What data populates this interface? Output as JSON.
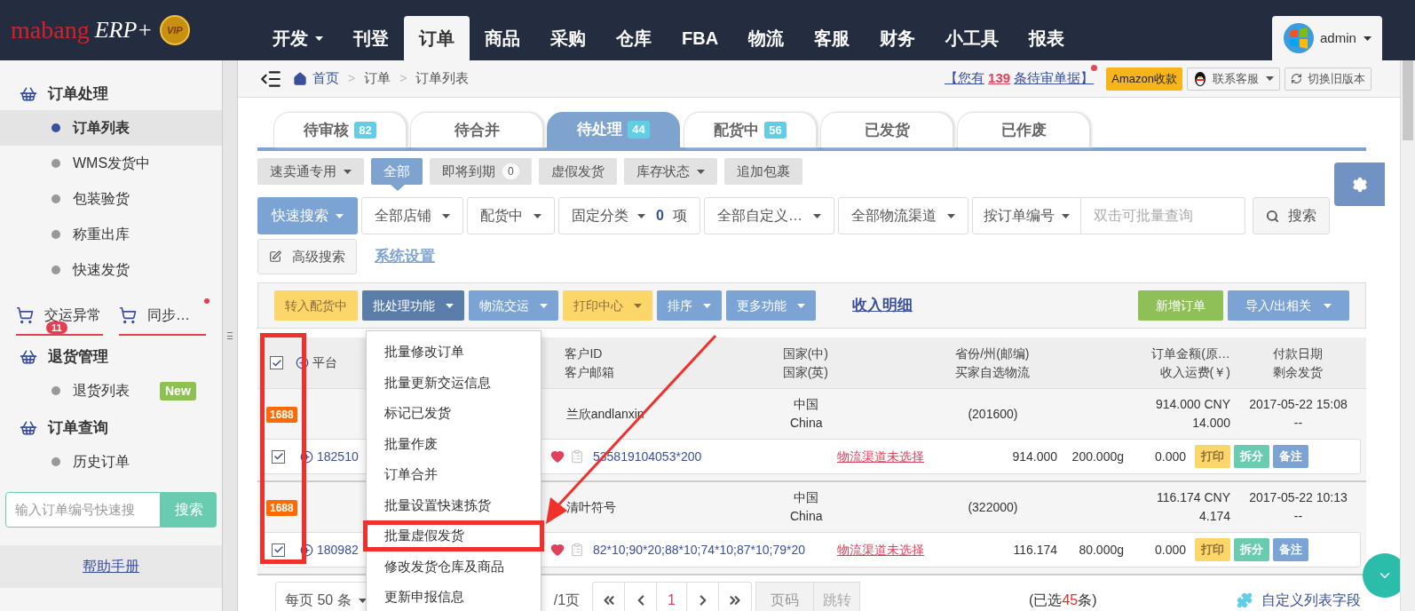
{
  "nav": {
    "logo_main": "mabang",
    "logo_suffix": "ERP+",
    "logo_badge": "VIP",
    "user": "admin",
    "items": [
      {
        "label": "开发",
        "dropdown": true,
        "selected": false
      },
      {
        "label": "刊登",
        "dropdown": false,
        "selected": false
      },
      {
        "label": "订单",
        "dropdown": false,
        "selected": true
      },
      {
        "label": "商品",
        "dropdown": false,
        "selected": false
      },
      {
        "label": "采购",
        "dropdown": false,
        "selected": false
      },
      {
        "label": "仓库",
        "dropdown": false,
        "selected": false
      },
      {
        "label": "FBA",
        "dropdown": false,
        "selected": false
      },
      {
        "label": "物流",
        "dropdown": false,
        "selected": false
      },
      {
        "label": "客服",
        "dropdown": false,
        "selected": false
      },
      {
        "label": "财务",
        "dropdown": false,
        "selected": false
      },
      {
        "label": "小工具",
        "dropdown": false,
        "selected": false
      },
      {
        "label": "报表",
        "dropdown": false,
        "selected": false
      }
    ]
  },
  "sidebar": {
    "sections": [
      {
        "kind": "group",
        "title": "订单处理",
        "items": [
          {
            "label": "订单列表",
            "selected": true
          },
          {
            "label": "WMS发货中",
            "selected": false
          },
          {
            "label": "包装验货",
            "selected": false
          },
          {
            "label": "称重出库",
            "selected": false
          },
          {
            "label": "快速发货",
            "selected": false
          }
        ]
      },
      {
        "kind": "tabs",
        "tabs": [
          {
            "label": "交运异常",
            "badge": "11",
            "dot": false
          },
          {
            "label": "同步…",
            "dot": true
          }
        ]
      },
      {
        "kind": "group",
        "title": "退货管理",
        "items": [
          {
            "label": "退货列表",
            "selected": false,
            "tag": "New"
          }
        ]
      },
      {
        "kind": "group",
        "title": "订单查询",
        "items": [
          {
            "label": "历史订单",
            "selected": false
          }
        ]
      }
    ],
    "search": {
      "placeholder": "输入订单编号快速搜",
      "button": "搜索"
    },
    "help": "帮助手册"
  },
  "breadcrumb": [
    "首页",
    "订单",
    "订单列表"
  ],
  "breadcrumb_separator": ">",
  "notice": {
    "prefix": "【您有",
    "count": "139",
    "suffix": "条待审单据】",
    "dot": true
  },
  "top_buttons": [
    {
      "kind": "amazon",
      "label": "Amazon收款"
    },
    {
      "kind": "service",
      "label": "联系客服"
    },
    {
      "kind": "switch",
      "label": "切换旧版本"
    }
  ],
  "tabs": [
    {
      "label": "待审核",
      "count": "82",
      "selected": false
    },
    {
      "label": "待合并",
      "selected": false
    },
    {
      "label": "待处理",
      "count": "44",
      "selected": true
    },
    {
      "label": "配货中",
      "count": "56",
      "selected": false
    },
    {
      "label": "已发货",
      "selected": false
    },
    {
      "label": "已作废",
      "selected": false
    }
  ],
  "sub_tabs": [
    {
      "label": "速卖通专用",
      "dropdown": true,
      "selected": false
    },
    {
      "label": "全部",
      "selected": true
    },
    {
      "label": "即将到期",
      "count": "0",
      "selected": false
    },
    {
      "label": "虚假发货",
      "selected": false
    },
    {
      "label": "库存状态",
      "dropdown": true,
      "selected": false
    },
    {
      "label": "追加包裹",
      "selected": false
    }
  ],
  "filters": [
    {
      "kind": "primary",
      "label": "快速搜索"
    },
    {
      "kind": "select",
      "label": "全部店铺"
    },
    {
      "kind": "select",
      "label": "配货中"
    },
    {
      "kind": "category",
      "label": "固定分类",
      "count": "0",
      "unit": "项"
    },
    {
      "kind": "select",
      "label": "全部自定义…"
    },
    {
      "kind": "select",
      "label": "全部物流渠道"
    }
  ],
  "search": {
    "field": "按订单编号",
    "placeholder": "双击可批量查询",
    "button": "搜索"
  },
  "advanced_search": "高级搜索",
  "system_settings": "系统设置",
  "toolbar": {
    "left": [
      {
        "label": "转入配货中",
        "color": "#fdd66a",
        "dropdown": false
      },
      {
        "label": "批处理功能",
        "color": "#5a7ea9",
        "dropdown": true
      },
      {
        "label": "物流交运",
        "color": "#7ba3d3",
        "dropdown": true
      },
      {
        "label": "打印中心",
        "color": "#fdd66a",
        "dropdown": true
      },
      {
        "label": "排序",
        "color": "#7ba3d3",
        "dropdown": true
      },
      {
        "label": "更多功能",
        "color": "#7ba3d3",
        "dropdown": true
      }
    ],
    "link": "收入明细",
    "right": [
      {
        "label": "新增订单",
        "color": "#8fbf57",
        "dropdown": false
      },
      {
        "label": "导入/出相关",
        "color": "#7ba3d3",
        "dropdown": true
      }
    ]
  },
  "menu": {
    "items": [
      {
        "label": "批量修改订单",
        "highlighted": false
      },
      {
        "label": "批量更新交运信息",
        "highlighted": false
      },
      {
        "label": "标记已发货",
        "highlighted": false
      },
      {
        "label": "批量作废",
        "highlighted": false
      },
      {
        "label": "订单合并",
        "highlighted": false
      },
      {
        "label": "批量设置快速拣货",
        "highlighted": false
      },
      {
        "label": "批量虚假发货",
        "highlighted": true
      },
      {
        "label": "修改发货仓库及商品",
        "highlighted": false
      },
      {
        "label": "更新申报信息",
        "highlighted": false
      }
    ]
  },
  "table": {
    "select_all_checked": true,
    "columns": [
      [
        "平台"
      ],
      [
        "客户ID",
        "客户邮箱"
      ],
      [
        "国家(中)",
        "国家(英)"
      ],
      [
        "省份/州(邮编)",
        "买家自选物流"
      ],
      [
        "订单金额(原…",
        "收入运费(￥)"
      ],
      [
        "付款日期",
        "剩余发货"
      ]
    ],
    "orders": [
      {
        "platform": "1688",
        "customer": "兰欣andlanxin",
        "country_cn": "中国",
        "country_en": "China",
        "province": "(201600)",
        "amount": "914.000 CNY",
        "freight": "14.000",
        "date": "2017-05-22 15:08",
        "remaining": "--",
        "checked": true,
        "order_id": "182510",
        "sku": "535819104053*200",
        "logistics": "物流渠道未选择",
        "total": "914.000",
        "weight": "200.000g",
        "cost": "0.000",
        "actions": [
          "打印",
          "拆分",
          "备注"
        ]
      },
      {
        "platform": "1688",
        "customer": "清叶符号",
        "country_cn": "中国",
        "country_en": "China",
        "province": "(322000)",
        "amount": "116.174 CNY",
        "freight": "4.174",
        "date": "2017-05-22 10:13",
        "remaining": "--",
        "checked": true,
        "order_id": "180982",
        "sku": "82*10;90*20;88*10;74*10;87*10;79*20",
        "logistics": "物流渠道未选择",
        "total": "116.174",
        "weight": "80.000g",
        "cost": "0.000",
        "actions": [
          "打印",
          "拆分",
          "备注"
        ]
      }
    ]
  },
  "pager": {
    "per_page_prefix": "每页",
    "per_page": "50",
    "per_page_suffix": "条",
    "pages": "/1页",
    "current": "1",
    "page_placeholder": "页码",
    "jump": "跳转",
    "selected_prefix": "(已选",
    "selected_count": "45",
    "selected_suffix": "条)",
    "custom_fields": "自定义列表字段"
  }
}
